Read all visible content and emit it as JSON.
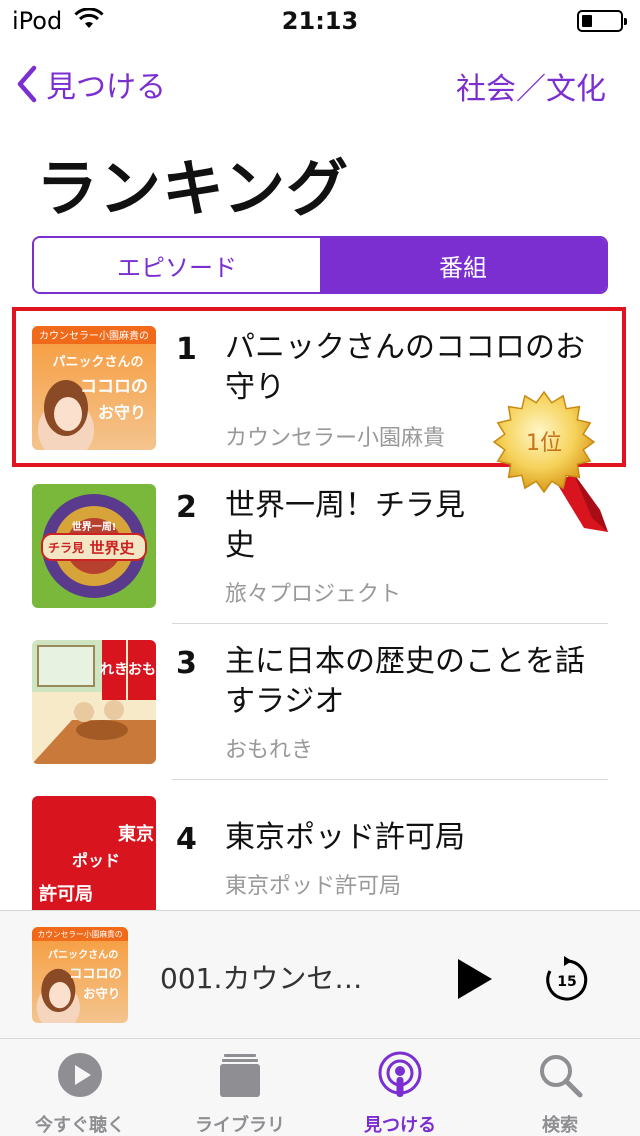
{
  "status_bar": {
    "carrier": "iPod",
    "time": "21:13"
  },
  "nav": {
    "back_label": "見つける",
    "category": "社会／文化"
  },
  "page_title": "ランキング",
  "segments": [
    {
      "label": "エピソード",
      "selected": false
    },
    {
      "label": "番組",
      "selected": true
    }
  ],
  "rankings": [
    {
      "rank": "1",
      "title": "パニックさんのココロのお守り",
      "author": "カウンセラー小園麻貴"
    },
    {
      "rank": "2",
      "title": "世界一周！チラ見史",
      "author": "旅々プロジェクト"
    },
    {
      "rank": "3",
      "title": "主に日本の歴史のことを話すラジオ",
      "author": "おもれき"
    },
    {
      "rank": "4",
      "title": "東京ポッド許可局",
      "author": "東京ポッド許可局"
    }
  ],
  "artwork": {
    "panic": {
      "top": "カウンセラー小園麻貴の",
      "line1": "パニックさんの",
      "line2": "ココロの",
      "line3": "お守り"
    },
    "world": {
      "line1": "世界一周!",
      "line2": "チラ見",
      "line3": "世界史"
    },
    "omoreki": {
      "col1": "おも",
      "col2": "れき"
    },
    "tokyo": {
      "col1": "東京",
      "col2": "ポッド",
      "col3": "許可局"
    }
  },
  "badge": {
    "label": "1位"
  },
  "mini_player": {
    "title": "001.カウンセ…"
  },
  "tabs": [
    {
      "label": "今すぐ聴く",
      "active": false
    },
    {
      "label": "ライブラリ",
      "active": false
    },
    {
      "label": "見つける",
      "active": true
    },
    {
      "label": "検索",
      "active": false
    }
  ],
  "skip_seconds": "15",
  "colors": {
    "accent": "#7b2fd0",
    "highlight": "#e0141e",
    "secondary_text": "#999999"
  }
}
